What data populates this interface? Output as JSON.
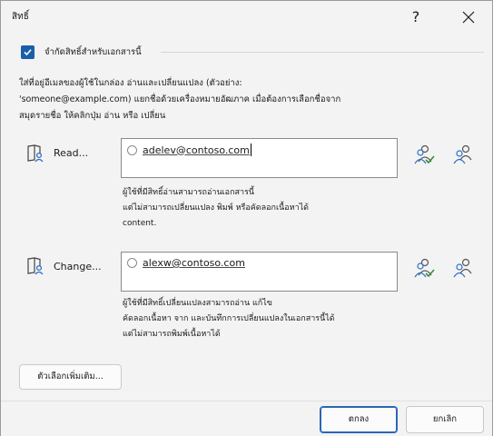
{
  "window": {
    "title": "สิทธิ์",
    "help_label": "?"
  },
  "restrict": {
    "checked": true,
    "label": "จำกัดสิทธิ์สำหรับเอกสารนี้"
  },
  "instructions": {
    "line1": "ใส่ที่อยู่อีเมลของผู้ใช้ในกล่อง อ่านและเปลี่ยนแปลง (ตัวอย่าง:",
    "line2": "'someone@example.com) แยกชื่อด้วยเครื่องหมายอัฒภาค เมื่อต้องการเลือกชื่อจาก",
    "line3": "สมุดรายชื่อ ให้คลิกปุ่ม อ่าน หรือ เปลี่ยน"
  },
  "read": {
    "label": "Read...",
    "user": "adelev@contoso.com",
    "desc1": "ผู้ใช้ที่มีสิทธิ์อ่านสามารถอ่านเอกสารนี้",
    "desc2": "แต่ไม่สามารถเปลี่ยนแปลง พิมพ์ หรือคัดลอกเนื้อหาได้",
    "desc3": "content."
  },
  "change": {
    "label": "Change...",
    "user": "alexw@contoso.com",
    "desc1": "ผู้ใช้ที่มีสิทธิ์เปลี่ยนแปลงสามารถอ่าน แก้ไข",
    "desc2": "คัดลอกเนื้อหา จาก และบันทึกการเปลี่ยนแปลงในเอกสารนี้ได้",
    "desc3": "แต่ไม่สามารถพิมพ์เนื้อหาได้"
  },
  "buttons": {
    "more": "ตัวเลือกเพิ่มเติม...",
    "ok": "ตกลง",
    "cancel": "ยกเลิก"
  },
  "icons": {
    "help": "help-icon",
    "close": "close-icon",
    "read": "people-document-icon",
    "change": "people-document-icon",
    "check_names": "check-names-icon",
    "address_book": "address-book-icon"
  },
  "colors": {
    "accent": "#1b5faa",
    "icon_blue": "#2b6fc7",
    "check_green": "#3a8a3a"
  }
}
